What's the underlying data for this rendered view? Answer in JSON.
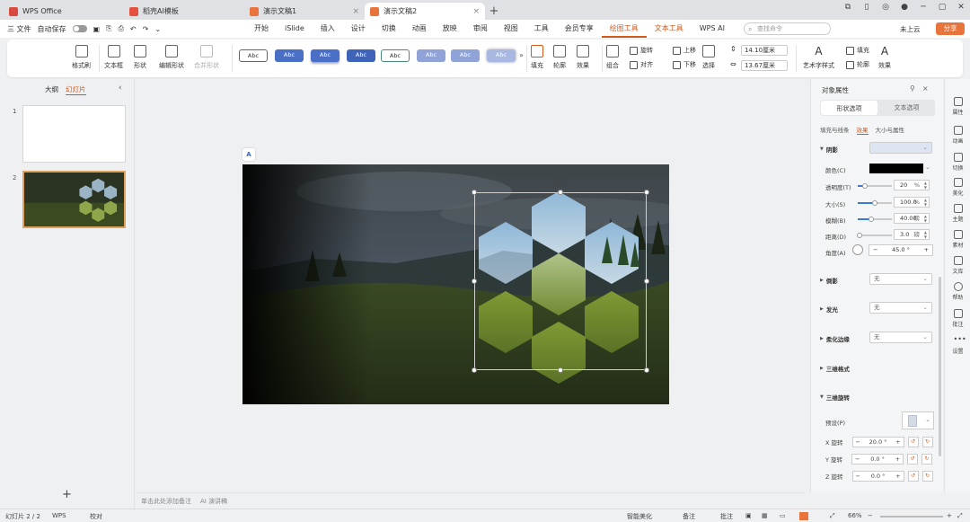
{
  "tabs": [
    {
      "label": "WPS Office",
      "color": "#d94a3e"
    },
    {
      "label": "稻壳AI模板",
      "color": "#e5513f"
    },
    {
      "label": "演示文稿1",
      "color": "#e8743b"
    },
    {
      "label": "演示文稿2",
      "color": "#e8743b"
    }
  ],
  "menu": {
    "file": "三 文件",
    "autosave": "自动保存",
    "tabs": [
      "开始",
      "iSlide",
      "插入",
      "设计",
      "切换",
      "动画",
      "放映",
      "审阅",
      "视图",
      "工具",
      "会员专享",
      "绘图工具",
      "文本工具",
      "WPS AI"
    ],
    "active_tab": "绘图工具",
    "search_placeholder": "查找命令",
    "cloud": "未上云",
    "share": "分享"
  },
  "ribbon": {
    "format_painter": "格式刷",
    "textbox": "文本框",
    "shape": "形状",
    "edit_shape": "编辑形状",
    "merge_shape": "合并形状",
    "style_label": "Abc",
    "fill": "填充",
    "outline": "轮廓",
    "effect": "效果",
    "combine": "组合",
    "rotate": "旋转",
    "align": "对齐",
    "up": "上移",
    "down": "下移",
    "select": "选择",
    "height": "14.10厘米",
    "width": "13.67厘米",
    "art_style": "艺术字样式",
    "text_fill": "填充",
    "text_outline": "轮廓",
    "text_effect": "效果"
  },
  "left_panel": {
    "tab_outline": "大纲",
    "tab_slides": "幻灯片",
    "slide_numbers": [
      "1",
      "2"
    ],
    "add": "+"
  },
  "ai_badge": "A",
  "notes_placeholder": "单击此处添加备注",
  "ai_speech": "AI 演讲稿",
  "right_panel": {
    "title": "对象属性",
    "seg_shape": "形状选项",
    "seg_text": "文本选项",
    "sub_fill": "填充与线条",
    "sub_effect": "效果",
    "sub_size": "大小与属性",
    "shadow": "阴影",
    "color_label": "颜色(C)",
    "transparency": {
      "label": "透明度(T)",
      "value": "20",
      "unit": "%",
      "level": 0.2
    },
    "size": {
      "label": "大小(S)",
      "value": "100.0",
      "unit": "%",
      "level": 0.5
    },
    "blur": {
      "label": "模糊(B)",
      "value": "40.00",
      "unit": "磅",
      "level": 0.4
    },
    "distance": {
      "label": "距离(D)",
      "value": "3.0",
      "unit": "磅",
      "level": 0.05
    },
    "angle": {
      "label": "角度(A)",
      "value": "45.0 °"
    },
    "reflection": "倒影",
    "glow": "发光",
    "soft_edge": "柔化边缘",
    "none": "无",
    "three_d_format": "三维格式",
    "three_d_rotation": "三维旋转",
    "preset": "预设(P)",
    "x_rot": {
      "label": "X 旋转",
      "value": "20.0 °"
    },
    "y_rot": {
      "label": "Y 旋转",
      "value": "0.0 °"
    },
    "z_rot": {
      "label": "Z 旋转",
      "value": "0.0 °"
    },
    "shadow_color": "#000000"
  },
  "rail": [
    "属性",
    "动画",
    "切换",
    "美化",
    "主题",
    "素材",
    "文库",
    "帮助",
    "批注",
    "设置"
  ],
  "status": {
    "slide": "幻灯片 2 / 2",
    "wps": "WPS",
    "proof": "校对",
    "smart": "智能美化",
    "notes": "备注",
    "comments": "批注",
    "zoom": "66%"
  }
}
